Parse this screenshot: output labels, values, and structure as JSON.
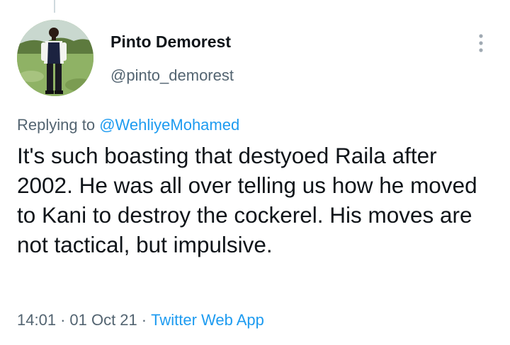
{
  "tweet": {
    "author": {
      "display_name": "Pinto Demorest",
      "handle": "@pinto_demorest",
      "avatar_icon": "profile-photo"
    },
    "menu_icon": "vertical-dots-icon",
    "replying_to_prefix": "Replying to",
    "replying_to_handle": "@WehliyeMohamed",
    "text": "It's such boasting that destyoed Raila after 2002. He was all over telling us how he moved to Kani to destroy the cockerel. His moves are not tactical, but impulsive.",
    "time": "14:01",
    "separator": "·",
    "date": "01 Oct 21",
    "source": "Twitter Web App"
  },
  "colors": {
    "text": "#0f1419",
    "secondary": "#536471",
    "link": "#1d9bf0",
    "thread_line": "#cfd9de"
  }
}
